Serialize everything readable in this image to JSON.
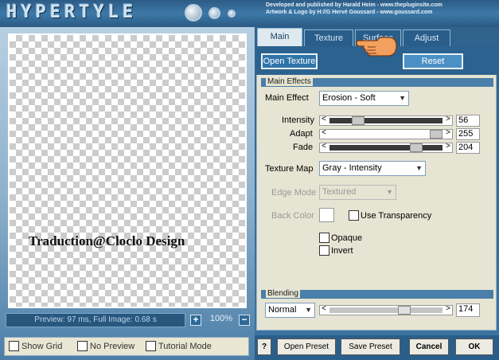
{
  "header": {
    "logo_text": "HYPERTYLE",
    "credits_line1": "Developed and published by Harald Heim - www.thepluginsite.com",
    "credits_line2": "Artwork & Logo by H://G Hervé Goussard - www.goussard.com"
  },
  "preview": {
    "watermark": "Traduction@Cloclo Design",
    "status": "Preview: 97 ms, Full Image: 0.68 s",
    "zoom_in": "+",
    "zoom_out": "−",
    "zoom_level": "100%"
  },
  "options": {
    "show_grid": "Show Grid",
    "no_preview": "No Preview",
    "tutorial_mode": "Tutorial Mode"
  },
  "tabs": [
    "Main",
    "Texture",
    "Surface",
    "Adjust"
  ],
  "top_buttons": {
    "open_texture": "Open Texture",
    "reset": "Reset"
  },
  "main_effects": {
    "section_title": "Main Effects",
    "main_effect_label": "Main Effect",
    "main_effect_value": "Erosion - Soft",
    "sliders": [
      {
        "label": "Intensity",
        "value": "56",
        "fraction": 0.22
      },
      {
        "label": "Adapt",
        "value": "255",
        "fraction": 1.0
      },
      {
        "label": "Fade",
        "value": "204",
        "fraction": 0.8
      }
    ],
    "texture_map_label": "Texture Map",
    "texture_map_value": "Gray - Intensity",
    "edge_mode_label": "Edge Mode",
    "edge_mode_value": "Textured",
    "back_color_label": "Back Color",
    "use_transparency": "Use Transparency",
    "opaque": "Opaque",
    "invert": "Invert"
  },
  "blending": {
    "section_title": "Blending",
    "mode": "Normal",
    "value": "174",
    "fraction": 0.68
  },
  "bottom_buttons": {
    "help": "?",
    "open_preset": "Open Preset",
    "save_preset": "Save Preset",
    "cancel": "Cancel",
    "ok": "OK"
  },
  "icons": {
    "pointer": "hand-pointer-icon",
    "chevron": "chevron-down-icon"
  },
  "colors": {
    "accent": "#2f74a8",
    "panel": "#e6e4d2",
    "header": "#3d79a8"
  }
}
